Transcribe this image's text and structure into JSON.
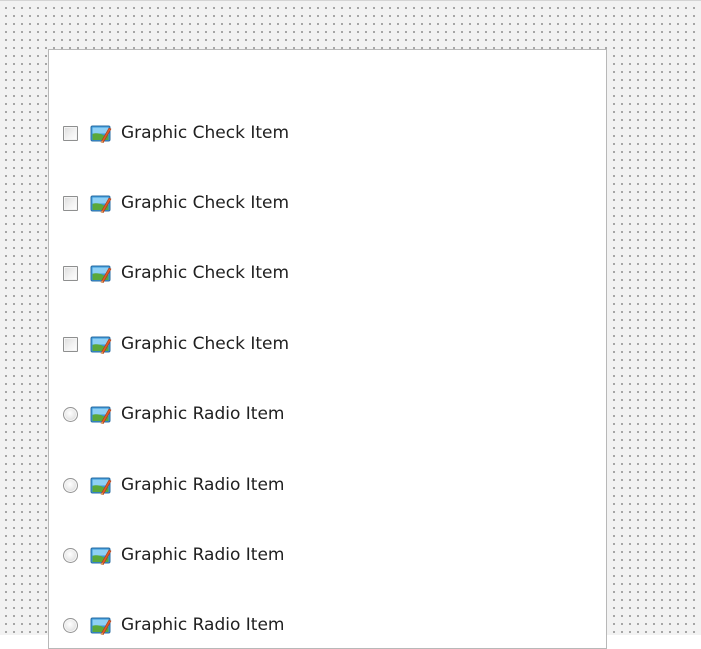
{
  "items": [
    {
      "type": "checkbox",
      "label": "Graphic Check Item",
      "checked": false,
      "icon": "image-edit-icon"
    },
    {
      "type": "checkbox",
      "label": "Graphic Check Item",
      "checked": false,
      "icon": "image-edit-icon"
    },
    {
      "type": "checkbox",
      "label": "Graphic Check Item",
      "checked": false,
      "icon": "image-edit-icon"
    },
    {
      "type": "checkbox",
      "label": "Graphic Check Item",
      "checked": false,
      "icon": "image-edit-icon"
    },
    {
      "type": "radio",
      "label": "Graphic Radio Item",
      "checked": false,
      "icon": "image-edit-icon"
    },
    {
      "type": "radio",
      "label": "Graphic Radio Item",
      "checked": false,
      "icon": "image-edit-icon"
    },
    {
      "type": "radio",
      "label": "Graphic Radio Item",
      "checked": false,
      "icon": "image-edit-icon"
    },
    {
      "type": "radio",
      "label": "Graphic Radio Item",
      "checked": false,
      "icon": "image-edit-icon"
    }
  ],
  "colors": {
    "surface": "#f2f2f2",
    "panel": "#ffffff",
    "panel_border": "#b8b8b8",
    "text": "#202020"
  }
}
